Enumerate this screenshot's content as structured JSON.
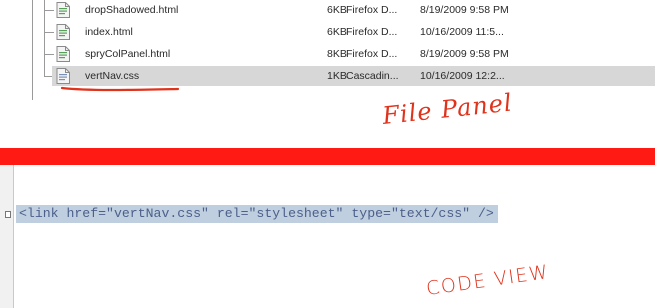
{
  "file_panel": {
    "files": [
      {
        "name": "dropShadowed.html",
        "size": "6KB",
        "type": "Firefox D...",
        "date": "8/19/2009 9:58 PM",
        "icon": "html-file-icon",
        "selected": false
      },
      {
        "name": "index.html",
        "size": "6KB",
        "type": "Firefox D...",
        "date": "10/16/2009 11:5...",
        "icon": "html-file-icon",
        "selected": false
      },
      {
        "name": "spryColPanel.html",
        "size": "8KB",
        "type": "Firefox D...",
        "date": "8/19/2009 9:58 PM",
        "icon": "html-file-icon",
        "selected": false
      },
      {
        "name": "vertNav.css",
        "size": "1KB",
        "type": "Cascadin...",
        "date": "10/16/2009 12:2...",
        "icon": "css-file-icon",
        "selected": true
      }
    ],
    "annotation": "File Panel"
  },
  "separator_color": "#ff1a14",
  "code_view": {
    "lines": [
      "<link href=\"vertNav.css\" rel=\"stylesheet\" type=\"text/css\" />"
    ],
    "annotation": "CODE VIEW"
  },
  "colors": {
    "annotation": "#e0331c",
    "code_highlight": "#bfcfe0",
    "code_text": "#4c5f8a",
    "selected_row": "#d7d7d7"
  }
}
